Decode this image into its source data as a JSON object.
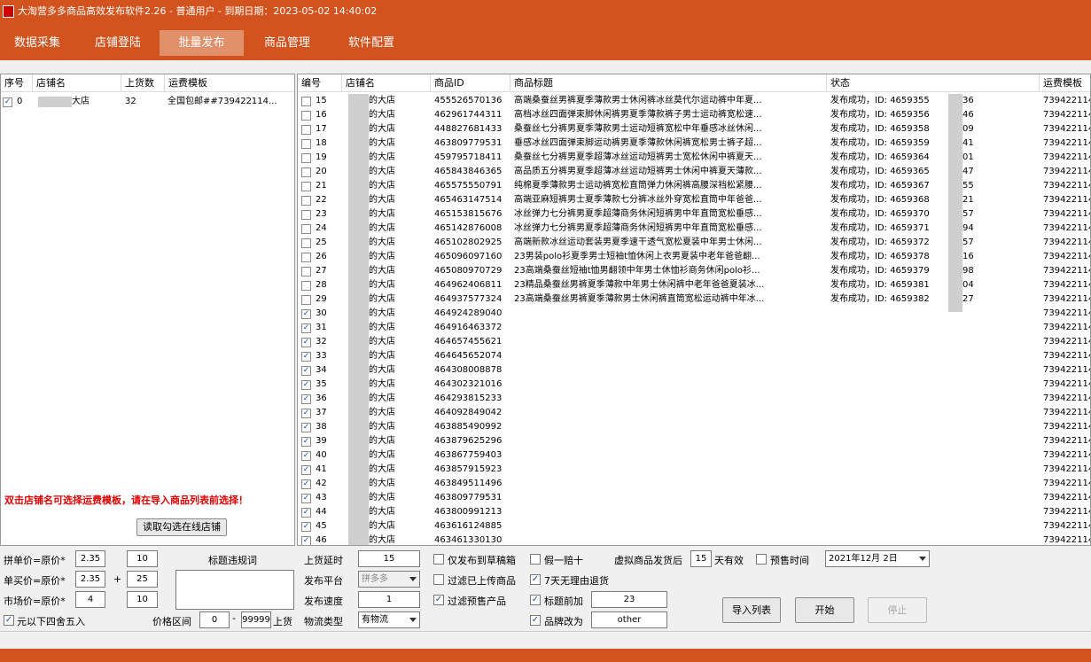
{
  "window": {
    "title": "大淘营多多商品高效发布软件2.26    -  普通用户  -   到期日期：2023-05-02 14:40:02"
  },
  "tabs": [
    {
      "label": "数据采集"
    },
    {
      "label": "店铺登陆"
    },
    {
      "label": "批量发布",
      "active": true
    },
    {
      "label": "商品管理"
    },
    {
      "label": "软件配置"
    }
  ],
  "left_table": {
    "headers": [
      "序号",
      "店铺名",
      "上货数",
      "运费模板"
    ],
    "rows": [
      {
        "checked": true,
        "index": "0",
        "shop": "大店",
        "count": "32",
        "template": "全国包邮##739422114..."
      }
    ]
  },
  "left_notice": "双击店铺名可选择运费模板，请在导入商品列表前选择！",
  "read_shops_button": "读取勾选在线店铺",
  "right_table": {
    "headers": [
      "编号",
      "店铺名",
      "商品ID",
      "商品标题",
      "状态",
      "运费模板"
    ],
    "rows": [
      {
        "checked": false,
        "num": "15",
        "shop": "的大店",
        "id": "455526570136",
        "title": "高端桑蚕丝男裤夏季薄款男士休闲裤冰丝莫代尔运动裤中年夏...",
        "status_a": "发布成功，ID: 4659355",
        "status_b": "36",
        "tpl": "739422114"
      },
      {
        "checked": false,
        "num": "16",
        "shop": "的大店",
        "id": "462961744311",
        "title": "高档冰丝四面弹束脚休闲裤男夏季薄款裤子男士运动裤宽松速...",
        "status_a": "发布成功，ID: 4659356",
        "status_b": "46",
        "tpl": "739422114"
      },
      {
        "checked": false,
        "num": "17",
        "shop": "的大店",
        "id": "448827681433",
        "title": "桑蚕丝七分裤男夏季薄款男士运动短裤宽松中年垂感冰丝休闲...",
        "status_a": "发布成功，ID: 4659358",
        "status_b": "09",
        "tpl": "739422114"
      },
      {
        "checked": false,
        "num": "18",
        "shop": "的大店",
        "id": "463809779531",
        "title": "垂感冰丝四面弹束脚运动裤男夏季薄款休闲裤宽松男士裤子超...",
        "status_a": "发布成功，ID: 4659359",
        "status_b": "41",
        "tpl": "739422114"
      },
      {
        "checked": false,
        "num": "19",
        "shop": "的大店",
        "id": "459795718411",
        "title": "桑蚕丝七分裤男夏季超薄冰丝运动短裤男士宽松休闲中裤夏天...",
        "status_a": "发布成功，ID: 4659364",
        "status_b": "01",
        "tpl": "739422114"
      },
      {
        "checked": false,
        "num": "20",
        "shop": "的大店",
        "id": "465843846365",
        "title": "高品质五分裤男夏季超薄冰丝运动短裤男士休闲中裤夏天薄款...",
        "status_a": "发布成功，ID: 4659365",
        "status_b": "47",
        "tpl": "739422114"
      },
      {
        "checked": false,
        "num": "21",
        "shop": "的大店",
        "id": "465575550791",
        "title": "纯棉夏季薄款男士运动裤宽松直筒弹力休闲裤高腰深裆松紧腰...",
        "status_a": "发布成功，ID: 4659367",
        "status_b": "55",
        "tpl": "739422114"
      },
      {
        "checked": false,
        "num": "22",
        "shop": "的大店",
        "id": "465463147514",
        "title": "高端亚麻短裤男士夏季薄款七分裤冰丝外穿宽松直筒中年爸爸...",
        "status_a": "发布成功，ID: 4659368",
        "status_b": "21",
        "tpl": "739422114"
      },
      {
        "checked": false,
        "num": "23",
        "shop": "的大店",
        "id": "465153815676",
        "title": "冰丝弹力七分裤男夏季超薄商务休闲短裤男中年直筒宽松垂感...",
        "status_a": "发布成功，ID: 4659370",
        "status_b": "57",
        "tpl": "739422114"
      },
      {
        "checked": false,
        "num": "24",
        "shop": "的大店",
        "id": "465142876008",
        "title": "冰丝弹力七分裤男夏季超薄商务休闲短裤男中年直筒宽松垂感...",
        "status_a": "发布成功，ID: 4659371",
        "status_b": "94",
        "tpl": "739422114"
      },
      {
        "checked": false,
        "num": "25",
        "shop": "的大店",
        "id": "465102802925",
        "title": "高端新款冰丝运动套装男夏季速干透气宽松夏装中年男士休闲...",
        "status_a": "发布成功，ID: 4659372",
        "status_b": "57",
        "tpl": "739422114"
      },
      {
        "checked": false,
        "num": "26",
        "shop": "的大店",
        "id": "465096097160",
        "title": "23男装polo衫夏季男士短袖t恤休闲上衣男夏装中老年爸爸翻...",
        "status_a": "发布成功，ID: 4659378",
        "status_b": "16",
        "tpl": "739422114"
      },
      {
        "checked": false,
        "num": "27",
        "shop": "的大店",
        "id": "465080970729",
        "title": "23高端桑蚕丝短袖t恤男翻领中年男士休恤衫商务休闲polo衫...",
        "status_a": "发布成功，ID: 4659379",
        "status_b": "98",
        "tpl": "739422114"
      },
      {
        "checked": false,
        "num": "28",
        "shop": "的大店",
        "id": "464962406811",
        "title": "23精品桑蚕丝男裤夏季薄款中年男士休闲裤中老年爸爸夏装冰...",
        "status_a": "发布成功，ID: 4659381",
        "status_b": "04",
        "tpl": "739422114"
      },
      {
        "checked": false,
        "num": "29",
        "shop": "的大店",
        "id": "464937577324",
        "title": "23高端桑蚕丝男裤夏季薄款男士休闲裤直筒宽松运动裤中年冰...",
        "status_a": "发布成功，ID: 4659382",
        "status_b": "27",
        "tpl": "739422114"
      },
      {
        "checked": true,
        "num": "30",
        "shop": "的大店",
        "id": "464924289040",
        "title": "",
        "status_a": "",
        "status_b": "",
        "tpl": "739422114"
      },
      {
        "checked": true,
        "num": "31",
        "shop": "的大店",
        "id": "464916463372",
        "title": "",
        "status_a": "",
        "status_b": "",
        "tpl": "739422114"
      },
      {
        "checked": true,
        "num": "32",
        "shop": "的大店",
        "id": "464657455621",
        "title": "",
        "status_a": "",
        "status_b": "",
        "tpl": "739422114"
      },
      {
        "checked": true,
        "num": "33",
        "shop": "的大店",
        "id": "464645652074",
        "title": "",
        "status_a": "",
        "status_b": "",
        "tpl": "739422114"
      },
      {
        "checked": true,
        "num": "34",
        "shop": "的大店",
        "id": "464308008878",
        "title": "",
        "status_a": "",
        "status_b": "",
        "tpl": "739422114"
      },
      {
        "checked": true,
        "num": "35",
        "shop": "的大店",
        "id": "464302321016",
        "title": "",
        "status_a": "",
        "status_b": "",
        "tpl": "739422114"
      },
      {
        "checked": true,
        "num": "36",
        "shop": "的大店",
        "id": "464293815233",
        "title": "",
        "status_a": "",
        "status_b": "",
        "tpl": "739422114"
      },
      {
        "checked": true,
        "num": "37",
        "shop": "的大店",
        "id": "464092849042",
        "title": "",
        "status_a": "",
        "status_b": "",
        "tpl": "739422114"
      },
      {
        "checked": true,
        "num": "38",
        "shop": "的大店",
        "id": "463885490992",
        "title": "",
        "status_a": "",
        "status_b": "",
        "tpl": "739422114"
      },
      {
        "checked": true,
        "num": "39",
        "shop": "的大店",
        "id": "463879625296",
        "title": "",
        "status_a": "",
        "status_b": "",
        "tpl": "739422114"
      },
      {
        "checked": true,
        "num": "40",
        "shop": "的大店",
        "id": "463867759403",
        "title": "",
        "status_a": "",
        "status_b": "",
        "tpl": "739422114"
      },
      {
        "checked": true,
        "num": "41",
        "shop": "的大店",
        "id": "463857915923",
        "title": "",
        "status_a": "",
        "status_b": "",
        "tpl": "739422114"
      },
      {
        "checked": true,
        "num": "42",
        "shop": "的大店",
        "id": "463849511496",
        "title": "",
        "status_a": "",
        "status_b": "",
        "tpl": "739422114"
      },
      {
        "checked": true,
        "num": "43",
        "shop": "的大店",
        "id": "463809779531",
        "title": "",
        "status_a": "",
        "status_b": "",
        "tpl": "739422114"
      },
      {
        "checked": true,
        "num": "44",
        "shop": "的大店",
        "id": "463800991213",
        "title": "",
        "status_a": "",
        "status_b": "",
        "tpl": "739422114"
      },
      {
        "checked": true,
        "num": "45",
        "shop": "的大店",
        "id": "463616124885",
        "title": "",
        "status_a": "",
        "status_b": "",
        "tpl": "739422114"
      },
      {
        "checked": true,
        "num": "46",
        "shop": "的大店",
        "id": "463461330130",
        "title": "",
        "status_a": "",
        "status_b": "",
        "tpl": "739422114"
      }
    ]
  },
  "settings": {
    "pin_price_label": "拼单价=原价*",
    "pin_price_mult": "2.35",
    "pin_price_add": "10",
    "single_price_label": "单买价=原价*",
    "single_price_mult": "2.35",
    "plus_sign": "+",
    "single_price_add": "25",
    "market_price_label": "市场价=原价*",
    "market_price_mult": "4",
    "market_price_add": "10",
    "round_label": "元以下四舍五入",
    "round_checked": true,
    "title_words_label": "标题违规词",
    "price_range_label": "价格区间",
    "price_min": "0",
    "price_dash": "-",
    "price_max": "99999",
    "price_suffix": "上货",
    "delay_label": "上货延时",
    "delay_value": "15",
    "platform_label": "发布平台",
    "platform_value": "拼多多",
    "speed_label": "发布速度",
    "speed_value": "1",
    "logistics_label": "物流类型",
    "logistics_value": "有物流",
    "draft_label": "仅发布到草稿箱",
    "draft_checked": false,
    "filter_uploaded_label": "过滤已上传商品",
    "filter_uploaded_checked": false,
    "filter_presale_label": "过滤预售产品",
    "filter_presale_checked": true,
    "fake_label": "假一赔十",
    "fake_checked": false,
    "return7_label": "7天无理由退货",
    "return7_checked": true,
    "title_prefix_label": "标题前加",
    "title_prefix_checked": true,
    "title_prefix_value": "23",
    "brand_label": "品牌改为",
    "brand_checked": true,
    "brand_value": "other",
    "virtual_label_a": "虚拟商品发货后",
    "virtual_days": "15",
    "virtual_label_b": "天有效",
    "presale_time_label": "预售时间",
    "presale_time_checked": false,
    "presale_date": "2021年12月 2日"
  },
  "buttons": {
    "import": "导入列表",
    "start": "开始",
    "stop": "停止"
  }
}
